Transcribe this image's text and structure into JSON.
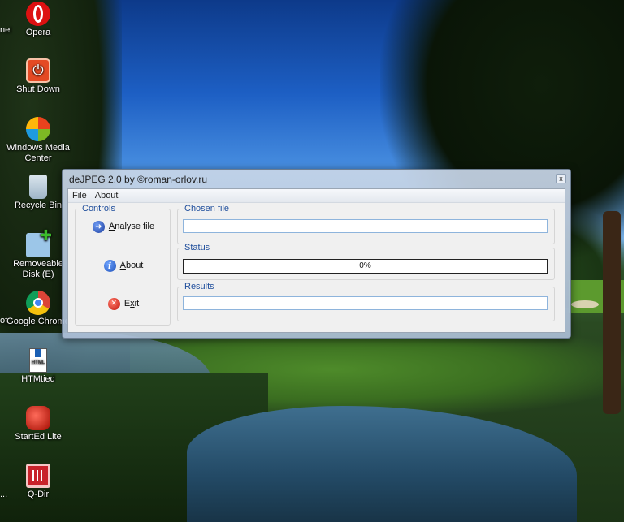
{
  "desktop": {
    "edge_texts": [
      "nel",
      "of",
      "..."
    ],
    "icons": [
      {
        "label": "Opera",
        "icon": "opera-icon"
      },
      {
        "label": "Shut Down",
        "icon": "power-icon"
      },
      {
        "label": "Windows Media Center",
        "icon": "windows-media-center-icon"
      },
      {
        "label": "Recycle Bin",
        "icon": "recycle-bin-icon"
      },
      {
        "label": "Removeable Disk (E)",
        "icon": "removable-disk-icon"
      },
      {
        "label": "Google Chrome",
        "icon": "chrome-icon"
      },
      {
        "label": "HTMtied",
        "icon": "html-file-icon"
      },
      {
        "label": "StartEd Lite",
        "icon": "started-lite-icon"
      },
      {
        "label": "Q-Dir",
        "icon": "q-dir-icon"
      }
    ]
  },
  "window": {
    "title": "deJPEG 2.0 by ©roman-orlov.ru",
    "close_glyph": "x",
    "menu": [
      "File",
      "About"
    ],
    "controls": {
      "label": "Controls",
      "analyse": {
        "accel": "A",
        "rest": "nalyse file",
        "icon": "arrow-right-icon"
      },
      "about": {
        "accel": "A",
        "rest": "bout",
        "icon": "info-icon"
      },
      "exit": {
        "pre": "E",
        "accel": "x",
        "rest": "it",
        "icon": "exit-icon"
      }
    },
    "chosen_file": {
      "label": "Chosen file",
      "value": ""
    },
    "status": {
      "label": "Status",
      "progress_percent": 0,
      "progress_text": "0%"
    },
    "results": {
      "label": "Results",
      "value": ""
    }
  }
}
